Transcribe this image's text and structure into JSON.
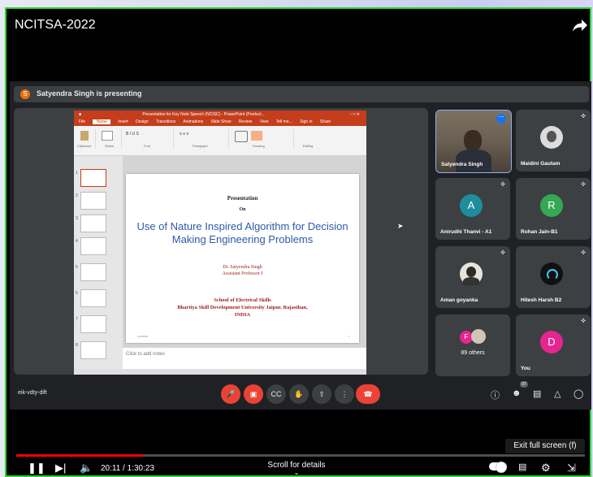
{
  "video_title": "NCITSA-2022",
  "presenting_initial": "S",
  "presenting_text": "Satyendra Singh is presenting",
  "ppt": {
    "window_title": "Presentation for Key Note Speech (NCISC) - PowerPoint (Product...",
    "tabs": [
      "File",
      "Home",
      "Insert",
      "Design",
      "Transitions",
      "Animations",
      "Slide Show",
      "Review",
      "View",
      "Tell me...",
      "Sign in",
      "Share"
    ],
    "ribbon_groups": [
      "Clipboard",
      "Slides",
      "Font",
      "Paragraph",
      "Drawing",
      "Editing"
    ],
    "slide_numbers": [
      "1",
      "2",
      "3",
      "4",
      "5",
      "6",
      "7",
      "8"
    ],
    "slide": {
      "presentation": "Presentation",
      "on": "On",
      "title": "Use of Nature Inspired Algorithm for Decision Making Engineering Problems",
      "author": "Dr. Satyendra Singh",
      "author_role": "Assistant Professor I",
      "school": "School of Electrical Skills",
      "university": "Bhartiya Skill Development University Jaipur, Rajasthan,",
      "country": "INDIA",
      "date": "2/18/2022",
      "page": "1"
    },
    "notes_placeholder": "Click to add notes"
  },
  "participants": [
    {
      "name": "Satyendra Singh",
      "type": "photo"
    },
    {
      "name": "Maidini Gautam",
      "type": "photo-avatar"
    },
    {
      "name": "Anirudhi Thanvi - A1",
      "initial": "A",
      "color": "#1e8e9e"
    },
    {
      "name": "Rohan Jain-B1",
      "initial": "R",
      "color": "#34a853"
    },
    {
      "name": "Aman goyanka",
      "type": "photo-avatar"
    },
    {
      "name": "Hitesh Harsh B2",
      "type": "logo-avatar"
    },
    {
      "name": "89 others",
      "initial": "F",
      "color": "#e52592"
    },
    {
      "name": "You",
      "initial": "D",
      "color": "#e52592"
    }
  ],
  "meeting_code": "eik-vdty-dift",
  "participant_count": "97",
  "youtube": {
    "exit_fullscreen": "Exit full screen (f)",
    "time": "20:11 / 1:30:23",
    "progress": 0.223,
    "scroll": "Scroll for details"
  }
}
